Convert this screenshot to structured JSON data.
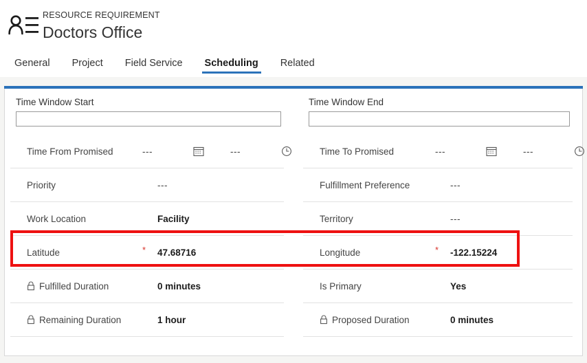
{
  "header": {
    "icon": "contact-record-icon",
    "entity_label": "RESOURCE REQUIREMENT",
    "record_title": "Doctors Office"
  },
  "tabs": [
    {
      "label": "General",
      "active": false
    },
    {
      "label": "Project",
      "active": false
    },
    {
      "label": "Field Service",
      "active": false
    },
    {
      "label": "Scheduling",
      "active": true
    },
    {
      "label": "Related",
      "active": false
    }
  ],
  "form": {
    "left": {
      "window": {
        "label": "Time Window Start",
        "value": "",
        "placeholder": ""
      },
      "datetime_row": {
        "label": "Time From Promised",
        "date_value": "---",
        "date_icon": "calendar-icon",
        "time_value": "---",
        "time_icon": "clock-icon"
      },
      "rows": [
        {
          "label": "Priority",
          "value": "---",
          "empty": true,
          "locked": false,
          "required": false
        },
        {
          "label": "Work Location",
          "value": "Facility",
          "empty": false,
          "locked": false,
          "required": false
        },
        {
          "label": "Latitude",
          "value": "47.68716",
          "empty": false,
          "locked": false,
          "required": true
        },
        {
          "label": "Fulfilled Duration",
          "value": "0 minutes",
          "empty": false,
          "locked": true,
          "required": false
        },
        {
          "label": "Remaining Duration",
          "value": "1 hour",
          "empty": false,
          "locked": true,
          "required": false
        }
      ]
    },
    "right": {
      "window": {
        "label": "Time Window End",
        "value": "",
        "placeholder": ""
      },
      "datetime_row": {
        "label": "Time To Promised",
        "date_value": "---",
        "date_icon": "calendar-icon",
        "time_value": "---",
        "time_icon": "clock-icon"
      },
      "rows": [
        {
          "label": "Fulfillment Preference",
          "value": "---",
          "empty": true,
          "locked": false,
          "required": false
        },
        {
          "label": "Territory",
          "value": "---",
          "empty": true,
          "locked": false,
          "required": false
        },
        {
          "label": "Longitude",
          "value": "-122.15224",
          "empty": false,
          "locked": false,
          "required": true
        },
        {
          "label": "Is Primary",
          "value": "Yes",
          "empty": false,
          "locked": false,
          "required": false
        },
        {
          "label": "Proposed Duration",
          "value": "0 minutes",
          "empty": false,
          "locked": true,
          "required": false
        }
      ]
    }
  },
  "annotation": {
    "name": "latitude-longitude-highlight",
    "color": "#ee1111"
  },
  "colors": {
    "accent_blue": "#2b72b9",
    "required_red": "#d8342b",
    "page_background": "#f5f5f3"
  }
}
